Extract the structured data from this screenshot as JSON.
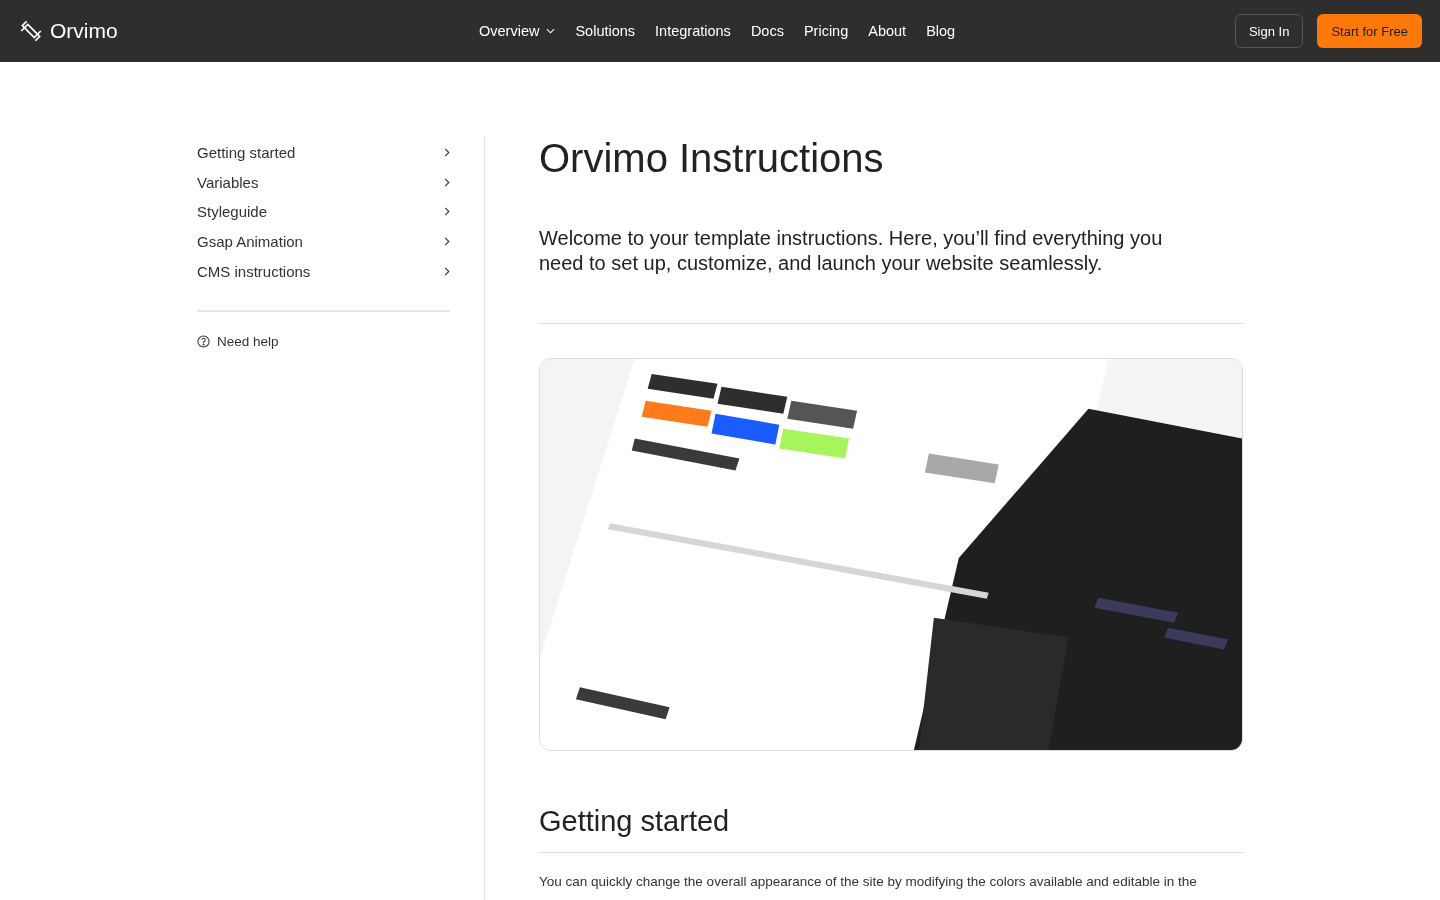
{
  "nav": {
    "brand": "Orvimo",
    "links": [
      {
        "label": "Overview",
        "dropdown": true
      },
      {
        "label": "Solutions",
        "dropdown": false
      },
      {
        "label": "Integrations",
        "dropdown": false
      },
      {
        "label": "Docs",
        "dropdown": false
      },
      {
        "label": "Pricing",
        "dropdown": false
      },
      {
        "label": "About",
        "dropdown": false
      },
      {
        "label": "Blog",
        "dropdown": false
      }
    ],
    "sign_in": "Sign In",
    "cta": "Start for Free"
  },
  "sidebar": {
    "items": [
      {
        "label": "Getting started"
      },
      {
        "label": "Variables"
      },
      {
        "label": "Styleguide"
      },
      {
        "label": "Gsap Animation"
      },
      {
        "label": "CMS instructions"
      }
    ],
    "help": "Need help"
  },
  "main": {
    "title": "Orvimo Instructions",
    "intro": "Welcome to your template instructions. Here, you’ll find everything you need to set up, customize, and launch your website seamlessly.",
    "section_title": "Getting started",
    "section_text": "You can quickly change the overall appearance of the site by modifying the colors available and editable in the"
  }
}
